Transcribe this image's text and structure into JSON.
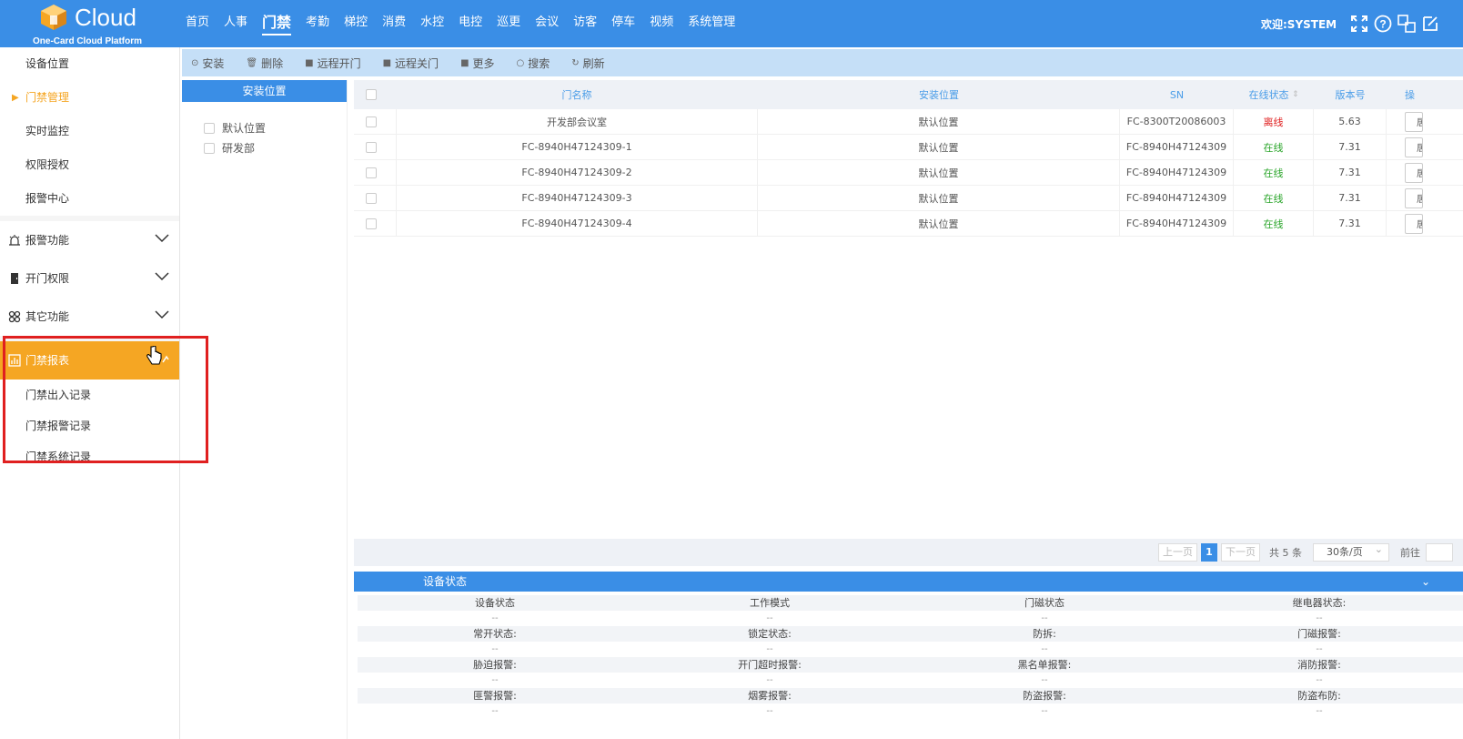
{
  "header": {
    "logo_text": "Cloud",
    "logo_sub": "One-Card Cloud Platform",
    "nav": [
      "首页",
      "人事",
      "门禁",
      "考勤",
      "梯控",
      "消费",
      "水控",
      "电控",
      "巡更",
      "会议",
      "访客",
      "停车",
      "视频",
      "系统管理"
    ],
    "nav_active_index": 2,
    "welcome": "欢迎:SYSTEM"
  },
  "sidebar": {
    "subs": [
      "设备位置",
      "门禁管理",
      "实时监控",
      "权限授权",
      "报警中心"
    ],
    "active_sub": "门禁管理",
    "groups": [
      {
        "label": "报警功能",
        "icon": "alarm-icon"
      },
      {
        "label": "开门权限",
        "icon": "door-icon"
      },
      {
        "label": "其它功能",
        "icon": "grid-icon"
      },
      {
        "label": "门禁报表",
        "icon": "chart-icon"
      }
    ],
    "report_children": [
      "门禁出入记录",
      "门禁报警记录",
      "门禁系统记录"
    ]
  },
  "toolbar": [
    "安装",
    "删除",
    "远程开门",
    "远程关门",
    "更多",
    "搜索",
    "刷新"
  ],
  "tree": {
    "header": "安装位置",
    "items": [
      "默认位置",
      "研发部"
    ]
  },
  "table": {
    "columns": [
      "门名称",
      "安装位置",
      "SN",
      "在线状态",
      "版本号",
      "操"
    ],
    "rows": [
      {
        "name": "开发部会议室",
        "location": "默认位置",
        "sn": "FC-8300T20086003",
        "status": "离线",
        "version": "5.63"
      },
      {
        "name": "FC-8940H47124309-1",
        "location": "默认位置",
        "sn": "FC-8940H47124309",
        "status": "在线",
        "version": "7.31"
      },
      {
        "name": "FC-8940H47124309-2",
        "location": "默认位置",
        "sn": "FC-8940H47124309",
        "status": "在线",
        "version": "7.31"
      },
      {
        "name": "FC-8940H47124309-3",
        "location": "默认位置",
        "sn": "FC-8940H47124309",
        "status": "在线",
        "version": "7.31"
      },
      {
        "name": "FC-8940H47124309-4",
        "location": "默认位置",
        "sn": "FC-8940H47124309",
        "status": "在线",
        "version": "7.31"
      }
    ],
    "op_label": "居"
  },
  "pager": {
    "prev": "上一页",
    "current": "1",
    "next": "下一页",
    "total": "共 5 条",
    "size": "30条/页",
    "goto": "前往"
  },
  "device_status": {
    "title": "设备状态",
    "labels": [
      [
        "设备状态",
        "工作模式",
        "门磁状态",
        "继电器状态:"
      ],
      [
        "常开状态:",
        "锁定状态:",
        "防拆:",
        "门磁报警:"
      ],
      [
        "胁迫报警:",
        "开门超时报警:",
        "黑名单报警:",
        "消防报警:"
      ],
      [
        "匪警报警:",
        "烟雾报警:",
        "防盗报警:",
        "防盗布防:"
      ]
    ],
    "empty_value": "--"
  },
  "colors": {
    "primary": "#3a8ee6",
    "accent": "#f5a623",
    "offline": "#e02020",
    "online": "#2aa52a"
  }
}
